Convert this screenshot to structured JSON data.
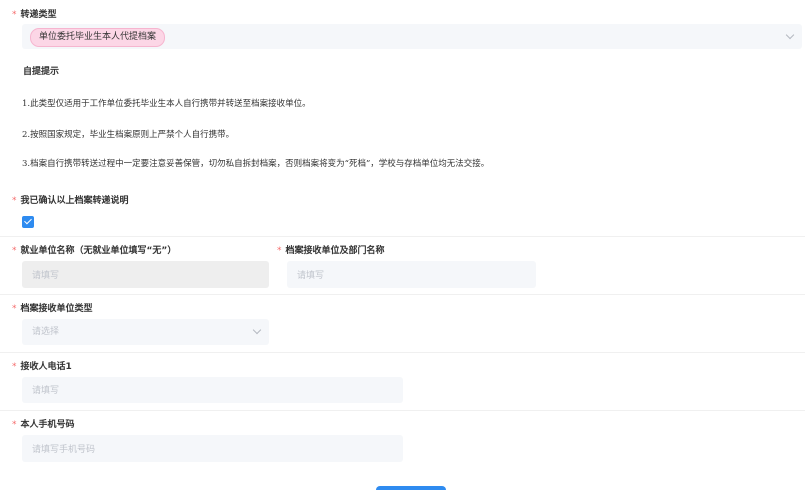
{
  "transfer_type": {
    "required_mark": "*",
    "label": "转递类型",
    "selected_tag": "单位委托毕业生本人代提档案"
  },
  "tips": {
    "title": "自提提示",
    "items": [
      "1.此类型仅适用于工作单位委托毕业生本人自行携带并转送至档案接收单位。",
      "2.按照国家规定，毕业生档案原则上严禁个人自行携带。",
      "3.档案自行携带转送过程中一定要注意妥善保管，切勿私自拆封档案，否则档案将变为“死档”，学校与存档单位均无法交接。"
    ]
  },
  "confirm": {
    "required_mark": "*",
    "label": "我已确认以上档案转递说明",
    "checked": true
  },
  "employer": {
    "required_mark": "*",
    "label": "就业单位名称（无就业单位填写“无”）",
    "placeholder": "请填写"
  },
  "receiver_unit": {
    "required_mark": "*",
    "label": "档案接收单位及部门名称",
    "placeholder": "请填写"
  },
  "receiver_type": {
    "required_mark": "*",
    "label": "档案接收单位类型",
    "placeholder": "请选择"
  },
  "receiver_phone": {
    "required_mark": "*",
    "label": "接收人电话1",
    "placeholder": "请填写"
  },
  "mobile": {
    "required_mark": "*",
    "label": "本人手机号码",
    "placeholder": "请填写手机号码"
  },
  "colors": {
    "required": "#f56c6c",
    "accent": "#2e8bf0",
    "tag_bg": "#fcd6e6",
    "field_bg": "#f5f7fa"
  }
}
